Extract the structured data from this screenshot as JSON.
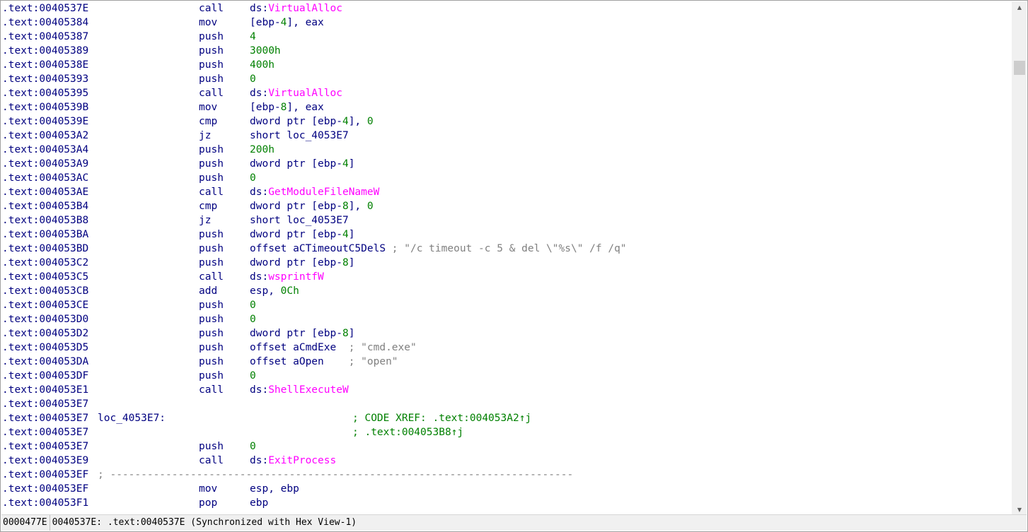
{
  "listing": {
    "lines": [
      {
        "addr": ".text:0040537E",
        "mnem": "call",
        "ops": [
          {
            "t": "ds:",
            "c": "n"
          },
          {
            "t": "VirtualAlloc",
            "c": "imp"
          }
        ]
      },
      {
        "addr": ".text:00405384",
        "mnem": "mov",
        "ops": [
          {
            "t": "[ebp-",
            "c": "n"
          },
          {
            "t": "4",
            "c": "num"
          },
          {
            "t": "], eax",
            "c": "n"
          }
        ]
      },
      {
        "addr": ".text:00405387",
        "mnem": "push",
        "ops": [
          {
            "t": "4",
            "c": "num"
          }
        ]
      },
      {
        "addr": ".text:00405389",
        "mnem": "push",
        "ops": [
          {
            "t": "3000h",
            "c": "num"
          }
        ]
      },
      {
        "addr": ".text:0040538E",
        "mnem": "push",
        "ops": [
          {
            "t": "400h",
            "c": "num"
          }
        ]
      },
      {
        "addr": ".text:00405393",
        "mnem": "push",
        "ops": [
          {
            "t": "0",
            "c": "num"
          }
        ]
      },
      {
        "addr": ".text:00405395",
        "mnem": "call",
        "ops": [
          {
            "t": "ds:",
            "c": "n"
          },
          {
            "t": "VirtualAlloc",
            "c": "imp"
          }
        ]
      },
      {
        "addr": ".text:0040539B",
        "mnem": "mov",
        "ops": [
          {
            "t": "[ebp-",
            "c": "n"
          },
          {
            "t": "8",
            "c": "num"
          },
          {
            "t": "], eax",
            "c": "n"
          }
        ]
      },
      {
        "addr": ".text:0040539E",
        "mnem": "cmp",
        "ops": [
          {
            "t": "dword ptr [ebp-",
            "c": "n"
          },
          {
            "t": "4",
            "c": "num"
          },
          {
            "t": "], ",
            "c": "n"
          },
          {
            "t": "0",
            "c": "num"
          }
        ]
      },
      {
        "addr": ".text:004053A2",
        "mnem": "jz",
        "ops": [
          {
            "t": "short loc_4053E7",
            "c": "n"
          }
        ]
      },
      {
        "addr": ".text:004053A4",
        "mnem": "push",
        "ops": [
          {
            "t": "200h",
            "c": "num"
          }
        ]
      },
      {
        "addr": ".text:004053A9",
        "mnem": "push",
        "ops": [
          {
            "t": "dword ptr [ebp-",
            "c": "n"
          },
          {
            "t": "4",
            "c": "num"
          },
          {
            "t": "]",
            "c": "n"
          }
        ]
      },
      {
        "addr": ".text:004053AC",
        "mnem": "push",
        "ops": [
          {
            "t": "0",
            "c": "num"
          }
        ]
      },
      {
        "addr": ".text:004053AE",
        "mnem": "call",
        "ops": [
          {
            "t": "ds:",
            "c": "n"
          },
          {
            "t": "GetModuleFileNameW",
            "c": "imp"
          }
        ]
      },
      {
        "addr": ".text:004053B4",
        "mnem": "cmp",
        "ops": [
          {
            "t": "dword ptr [ebp-",
            "c": "n"
          },
          {
            "t": "8",
            "c": "num"
          },
          {
            "t": "], ",
            "c": "n"
          },
          {
            "t": "0",
            "c": "num"
          }
        ]
      },
      {
        "addr": ".text:004053B8",
        "mnem": "jz",
        "ops": [
          {
            "t": "short loc_4053E7",
            "c": "n"
          }
        ]
      },
      {
        "addr": ".text:004053BA",
        "mnem": "push",
        "ops": [
          {
            "t": "dword ptr [ebp-",
            "c": "n"
          },
          {
            "t": "4",
            "c": "num"
          },
          {
            "t": "]",
            "c": "n"
          }
        ]
      },
      {
        "addr": ".text:004053BD",
        "mnem": "push",
        "ops": [
          {
            "t": "offset aCTimeoutC5DelS ",
            "c": "n"
          },
          {
            "t": "; \"/c timeout -c 5 & del \\\"%s\\\" /f /q\"",
            "c": "cmt"
          }
        ]
      },
      {
        "addr": ".text:004053C2",
        "mnem": "push",
        "ops": [
          {
            "t": "dword ptr [ebp-",
            "c": "n"
          },
          {
            "t": "8",
            "c": "num"
          },
          {
            "t": "]",
            "c": "n"
          }
        ]
      },
      {
        "addr": ".text:004053C5",
        "mnem": "call",
        "ops": [
          {
            "t": "ds:",
            "c": "n"
          },
          {
            "t": "wsprintfW",
            "c": "imp"
          }
        ]
      },
      {
        "addr": ".text:004053CB",
        "mnem": "add",
        "ops": [
          {
            "t": "esp, ",
            "c": "n"
          },
          {
            "t": "0Ch",
            "c": "num"
          }
        ]
      },
      {
        "addr": ".text:004053CE",
        "mnem": "push",
        "ops": [
          {
            "t": "0",
            "c": "num"
          }
        ]
      },
      {
        "addr": ".text:004053D0",
        "mnem": "push",
        "ops": [
          {
            "t": "0",
            "c": "num"
          }
        ]
      },
      {
        "addr": ".text:004053D2",
        "mnem": "push",
        "ops": [
          {
            "t": "dword ptr [ebp-",
            "c": "n"
          },
          {
            "t": "8",
            "c": "num"
          },
          {
            "t": "]",
            "c": "n"
          }
        ]
      },
      {
        "addr": ".text:004053D5",
        "mnem": "push",
        "ops": [
          {
            "t": "offset aCmdExe  ",
            "c": "n"
          },
          {
            "t": "; \"cmd.exe\"",
            "c": "cmt"
          }
        ]
      },
      {
        "addr": ".text:004053DA",
        "mnem": "push",
        "ops": [
          {
            "t": "offset aOpen    ",
            "c": "n"
          },
          {
            "t": "; \"open\"",
            "c": "cmt"
          }
        ]
      },
      {
        "addr": ".text:004053DF",
        "mnem": "push",
        "ops": [
          {
            "t": "0",
            "c": "num"
          }
        ]
      },
      {
        "addr": ".text:004053E1",
        "mnem": "call",
        "ops": [
          {
            "t": "ds:",
            "c": "n"
          },
          {
            "t": "ShellExecuteW",
            "c": "imp"
          }
        ]
      },
      {
        "addr": ".text:004053E7"
      },
      {
        "addr": ".text:004053E7",
        "label": "loc_4053E7:",
        "xref": "; CODE XREF: .text:004053A2↑j"
      },
      {
        "addr": ".text:004053E7",
        "xref": "; .text:004053B8↑j"
      },
      {
        "addr": ".text:004053E7",
        "mnem": "push",
        "ops": [
          {
            "t": "0",
            "c": "num"
          }
        ]
      },
      {
        "addr": ".text:004053E9",
        "mnem": "call",
        "ops": [
          {
            "t": "ds:",
            "c": "n"
          },
          {
            "t": "ExitProcess",
            "c": "imp"
          }
        ]
      },
      {
        "addr": ".text:004053EF",
        "separator": "; ---------------------------------------------------------------------------"
      },
      {
        "addr": ".text:004053EF",
        "mnem": "mov",
        "ops": [
          {
            "t": "esp, ebp",
            "c": "n"
          }
        ]
      },
      {
        "addr": ".text:004053F1",
        "mnem": "pop",
        "ops": [
          {
            "t": "ebp",
            "c": "n"
          }
        ]
      }
    ]
  },
  "colors": {
    "address": "#000080",
    "number": "#008000",
    "import": "#ff00ff",
    "comment": "#808080",
    "xref": "#008000"
  },
  "statusbar": {
    "file_offset": "0000477E",
    "location": "0040537E: .text:0040537E (Synchronized with Hex View-1)"
  },
  "scrollbar": {
    "up_icon": "up-arrow",
    "down_icon": "down-arrow"
  }
}
